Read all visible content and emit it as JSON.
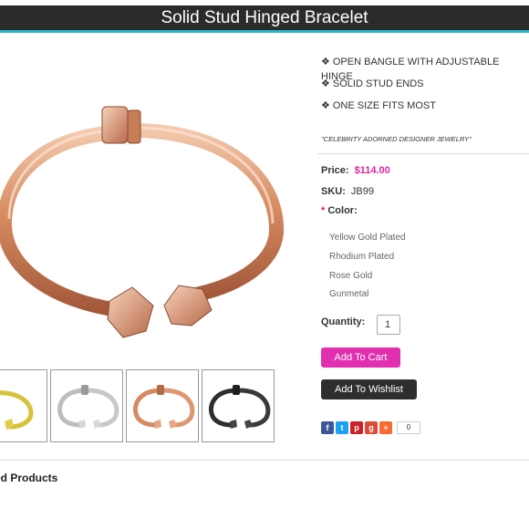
{
  "product": {
    "title": "Solid Stud Hinged Bracelet",
    "features": [
      "OPEN BANGLE WITH ADJUSTABLE HINGE",
      "SOLID STUD ENDS",
      "ONE SIZE FITS MOST"
    ],
    "tagline": "\"CELEBRITY ADORNED DESIGNER JEWELRY\"",
    "price_label": "Price:",
    "price": "$114.00",
    "sku_label": "SKU:",
    "sku": "JB99",
    "color_required": "*",
    "color_label": "Color:",
    "color_options": [
      "Yellow Gold Plated",
      "Rhodium Plated",
      "Rose Gold",
      "Gunmetal"
    ],
    "quantity_label": "Quantity:",
    "quantity": "1",
    "add_to_cart": "Add To Cart",
    "add_to_wishlist": "Add To Wishlist",
    "share_count": "0",
    "share_icons": [
      "facebook-icon",
      "twitter-icon",
      "pinterest-icon",
      "googleplus-icon",
      "addthis-icon"
    ],
    "related_heading": "ted Products",
    "thumbnails": [
      "yellow-gold",
      "rhodium",
      "rose-gold",
      "gunmetal"
    ]
  },
  "colors": {
    "accent": "#e22fb0",
    "price": "#e0249c",
    "titlebar": "#2b2b2b",
    "titlebar_border": "#2fb3c9",
    "wishlist": "#2e2e2e"
  }
}
